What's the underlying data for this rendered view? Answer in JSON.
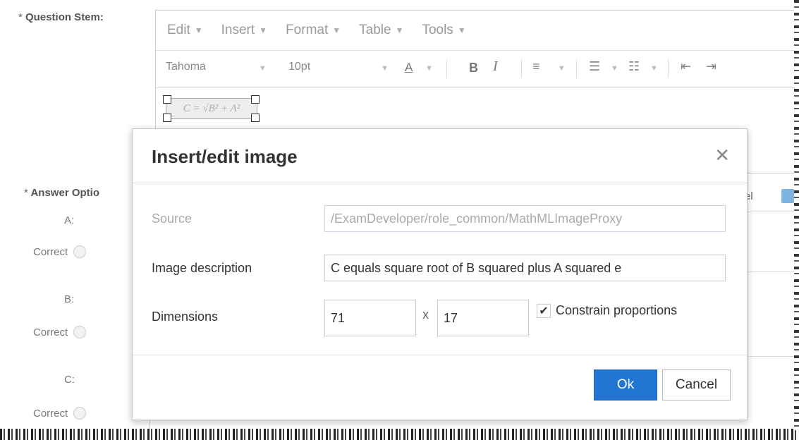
{
  "question_stem": {
    "label": "Question Stem:",
    "required_mark": "*"
  },
  "editor": {
    "menu": [
      {
        "label": "Edit"
      },
      {
        "label": "Insert"
      },
      {
        "label": "Format"
      },
      {
        "label": "Table"
      },
      {
        "label": "Tools"
      }
    ],
    "toolbar": {
      "font_family": "Tahoma",
      "font_size": "10pt",
      "font_color_label": "A",
      "bold_label": "B",
      "italic_label": "I"
    },
    "formula_text": "C = √B² + A²"
  },
  "answer_options": {
    "label": "Answer Optio",
    "required_mark": "*",
    "options": [
      {
        "letter": "A:",
        "correct_label": "Correct"
      },
      {
        "letter": "B:",
        "correct_label": "Correct"
      },
      {
        "letter": "C:",
        "correct_label": "Correct"
      }
    ],
    "right_column_text": "el"
  },
  "dialog": {
    "title": "Insert/edit image",
    "close_icon": "close-icon",
    "source_label": "Source",
    "source_value": "/ExamDeveloper/role_common/MathMLImageProxy",
    "description_label": "Image description",
    "description_value": "C equals square root of B squared plus A squared e",
    "dimensions_label": "Dimensions",
    "width_value": "71",
    "by_separator": "x",
    "height_value": "17",
    "constrain_label": "Constrain proportions",
    "constrain_checked": true,
    "ok_label": "Ok",
    "cancel_label": "Cancel",
    "accent_color": "#2276d2"
  }
}
